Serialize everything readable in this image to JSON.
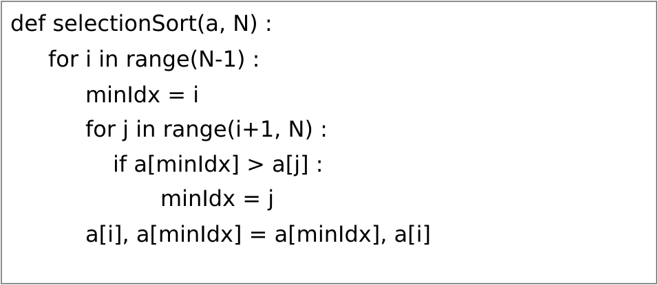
{
  "code": {
    "lines": [
      "def selectionSort(a, N) :",
      "for i in range(N-1) :",
      "minIdx = i",
      "for j in range(i+1, N) :",
      "if a[minIdx] > a[j] :",
      "minIdx = j",
      "a[i], a[minIdx] = a[minIdx], a[i]"
    ]
  }
}
